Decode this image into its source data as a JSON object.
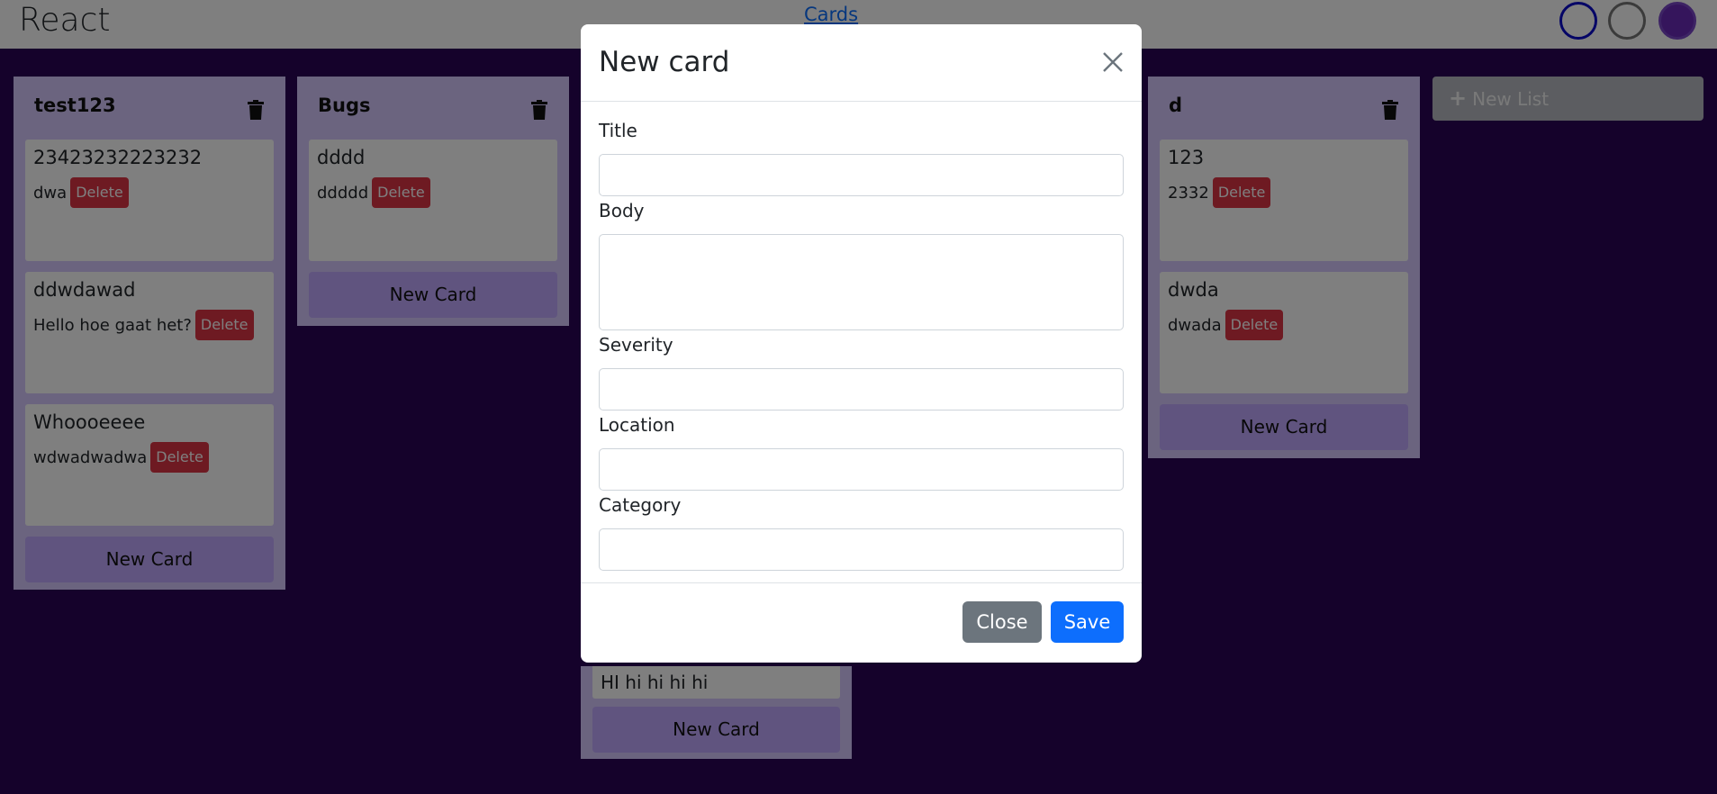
{
  "navbar": {
    "brand": "React",
    "link": "Cards"
  },
  "theme_colors": [
    "#0a0acc",
    "#777777",
    "#6b2bb8"
  ],
  "lists": [
    {
      "title": "test123",
      "cards": [
        {
          "title": "23423232223232",
          "body": "dwa"
        },
        {
          "title": "ddwdawad",
          "body": "Hello hoe gaat het?"
        },
        {
          "title": "Whoooeeee",
          "body": "wdwadwadwa"
        }
      ],
      "new_card_label": "New Card"
    },
    {
      "title": "Bugs",
      "cards": [
        {
          "title": "dddd",
          "body": "ddddd"
        }
      ],
      "new_card_label": "New Card"
    },
    {
      "title": "d",
      "cards": [
        {
          "title": "123",
          "body": "2332"
        },
        {
          "title": "dwda",
          "body": "dwada"
        }
      ],
      "new_card_label": "New Card"
    }
  ],
  "partial_list": {
    "card_title": "HI hi hi hi hi",
    "new_card_label": "New Card"
  },
  "delete_label": "Delete",
  "new_list_label": "New List",
  "modal": {
    "title": "New card",
    "fields": {
      "title": {
        "label": "Title",
        "value": ""
      },
      "body": {
        "label": "Body",
        "value": ""
      },
      "severity": {
        "label": "Severity",
        "value": ""
      },
      "location": {
        "label": "Location",
        "value": ""
      },
      "category": {
        "label": "Category",
        "value": ""
      }
    },
    "close_label": "Close",
    "save_label": "Save"
  }
}
